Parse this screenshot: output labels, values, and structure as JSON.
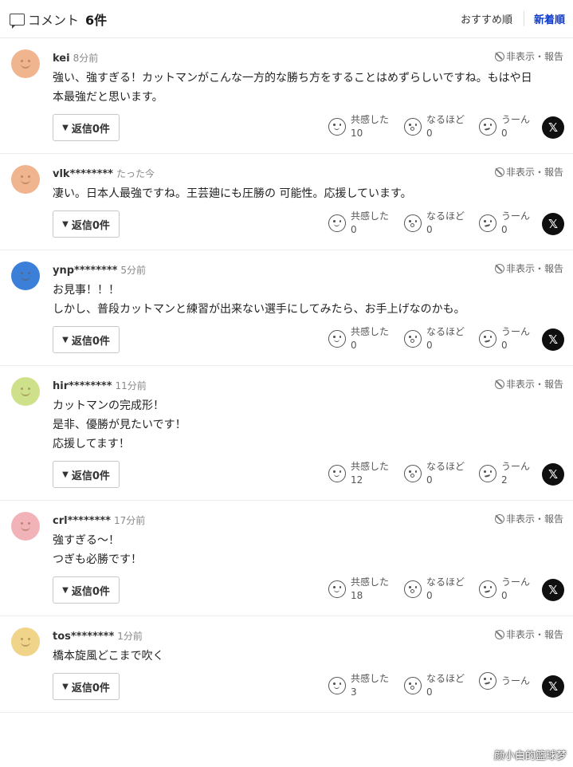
{
  "header": {
    "title": "コメント",
    "count": "6件",
    "sort_recommended": "おすすめ順",
    "sort_new": "新着順"
  },
  "labels": {
    "report": "非表示・報告",
    "reply": "返信0件",
    "react_empathy": "共感した",
    "react_indeed": "なるほど",
    "react_hmm": "うーん",
    "share_x": "𝕏"
  },
  "comments": [
    {
      "user": "kei",
      "time": "8分前",
      "avatar_color": "#f0b48f",
      "lines": [
        "強い、強すぎる！カットマンがこんな一方的な勝ち方をすることはめずらしいですね。もはや日",
        "本最強だと思います。",
        ""
      ],
      "empathy": "10",
      "indeed": "0",
      "hmm": "0"
    },
    {
      "user": "vlk********",
      "time": "たった今",
      "avatar_color": "#f0b48f",
      "lines": [
        "凄い。日本人最強ですね。王芸廸にも圧勝の 可能性。応援しています。",
        "",
        ""
      ],
      "empathy": "0",
      "indeed": "0",
      "hmm": "0"
    },
    {
      "user": "ynp********",
      "time": "5分前",
      "avatar_color": "#3b7fd9",
      "lines": [
        "お見事！！！",
        "しかし、普段カットマンと練習が出来ない選手にしてみたら、お手上げなのかも。",
        ""
      ],
      "empathy": "0",
      "indeed": "0",
      "hmm": "0"
    },
    {
      "user": "hir********",
      "time": "11分前",
      "avatar_color": "#cfe08a",
      "lines": [
        "カットマンの完成形！",
        "是非、優勝が見たいです！",
        "応援してます！"
      ],
      "empathy": "12",
      "indeed": "0",
      "hmm": "2"
    },
    {
      "user": "crl********",
      "time": "17分前",
      "avatar_color": "#f2b3b8",
      "lines": [
        "強すぎる〜！",
        "つぎも必勝です！",
        ""
      ],
      "empathy": "18",
      "indeed": "0",
      "hmm": "0"
    },
    {
      "user": "tos********",
      "time": "1分前",
      "avatar_color": "#f0d48a",
      "lines": [
        "橋本旋風どこまで吹く",
        "",
        ""
      ],
      "empathy": "3",
      "indeed": "0",
      "hmm": ""
    }
  ],
  "watermark": "颜小白的篮球梦"
}
